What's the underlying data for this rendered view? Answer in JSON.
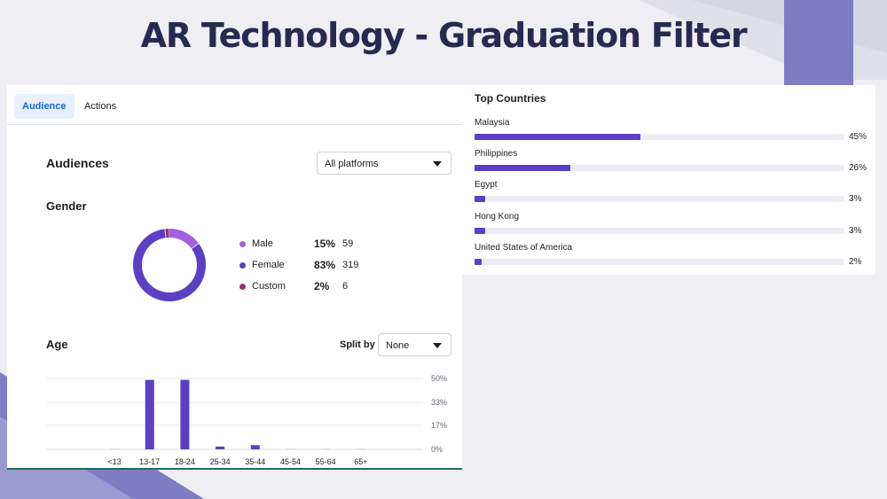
{
  "slide": {
    "title": "AR Technology - Graduation Filter"
  },
  "colors": {
    "accent": "#5b3fc4",
    "tab_active_bg": "#e7f0fd",
    "tab_active_text": "#1664d8",
    "bar_track": "#ebedf2",
    "bg_shape_purple": "#7e7cc2"
  },
  "tabs": [
    {
      "label": "Audience",
      "active": true
    },
    {
      "label": "Actions",
      "active": false
    }
  ],
  "audiences": {
    "title": "Audiences",
    "platform_select": {
      "value": "All platforms",
      "icon": "chevron-down-icon"
    }
  },
  "gender": {
    "title": "Gender",
    "items": [
      {
        "label": "Male",
        "percent": "15%",
        "count": "59",
        "color": "#a25fe0"
      },
      {
        "label": "Female",
        "percent": "83%",
        "count": "319",
        "color": "#5b3fc4"
      },
      {
        "label": "Custom",
        "percent": "2%",
        "count": "6",
        "color": "#9a2f6e"
      }
    ]
  },
  "age": {
    "title": "Age",
    "split_label": "Split by",
    "split_select": {
      "value": "None",
      "icon": "chevron-down-icon"
    }
  },
  "chart_data": {
    "type": "bar",
    "categories": [
      "<13",
      "13-17",
      "18-24",
      "25-34",
      "35-44",
      "45-54",
      "55-64",
      "65+"
    ],
    "values": [
      0.4,
      49,
      49,
      2,
      3,
      0.4,
      0.4,
      0.4
    ],
    "y_tick_labels": [
      "0%",
      "17%",
      "33%",
      "50%"
    ],
    "y_tick_values": [
      0,
      17,
      33,
      50
    ],
    "ylim": [
      0,
      50
    ],
    "grid": true,
    "bar_color": "#5b3fc4",
    "title": "",
    "xlabel": "",
    "ylabel": ""
  },
  "top_countries": {
    "title": "Top Countries",
    "items": [
      {
        "name": "Malaysia",
        "percent": "45%",
        "value": 45
      },
      {
        "name": "Philippines",
        "percent": "26%",
        "value": 26
      },
      {
        "name": "Egypt",
        "percent": "3%",
        "value": 3
      },
      {
        "name": "Hong Kong",
        "percent": "3%",
        "value": 3
      },
      {
        "name": "United States of America",
        "percent": "2%",
        "value": 2
      }
    ]
  }
}
